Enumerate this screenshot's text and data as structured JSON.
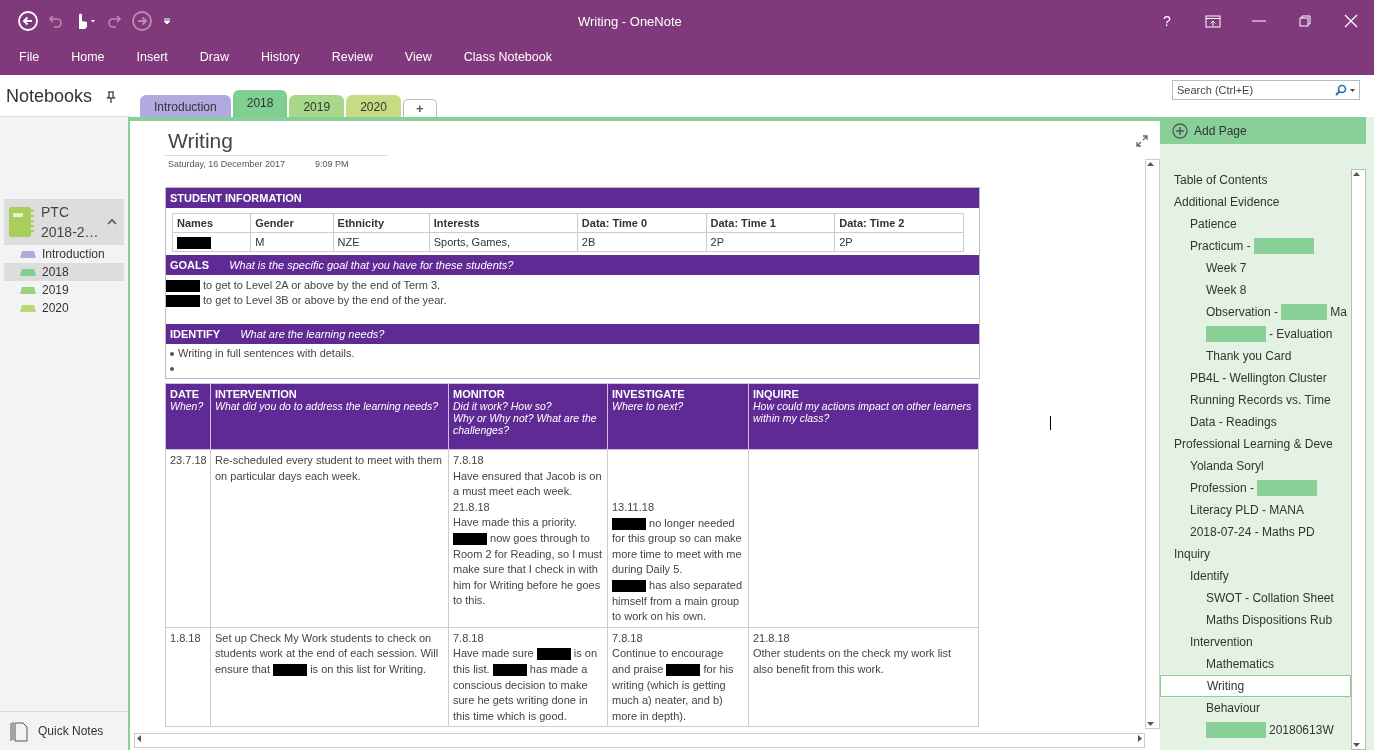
{
  "window": {
    "title": "Writing - OneNote",
    "help": "?"
  },
  "ribbon_tabs": [
    {
      "label": "File",
      "selected": false
    },
    {
      "label": "Home",
      "selected": false
    },
    {
      "label": "Insert",
      "selected": false
    },
    {
      "label": "Draw",
      "selected": false
    },
    {
      "label": "History",
      "selected": false
    },
    {
      "label": "Review",
      "selected": false
    },
    {
      "label": "View",
      "selected": false
    },
    {
      "label": "Class Notebook",
      "selected": false
    }
  ],
  "notebooks_pane": {
    "header": "Notebooks",
    "notebook": {
      "name": "PTC 2018-2…",
      "expanded": true
    },
    "sections": [
      {
        "name": "Introduction",
        "color": "#b1aae0",
        "selected": false
      },
      {
        "name": "2018",
        "color": "#7fcf92",
        "selected": true
      },
      {
        "name": "2019",
        "color": "#97d27f",
        "selected": false
      },
      {
        "name": "2020",
        "color": "#b8d874",
        "selected": false
      }
    ],
    "footer": "Quick Notes"
  },
  "section_tabs": [
    {
      "name": "Introduction",
      "color": "#b1aae0",
      "selected": false
    },
    {
      "name": "2018",
      "color": "#7fcf92",
      "selected": true
    },
    {
      "name": "2019",
      "color": "#a8d88a",
      "selected": false
    },
    {
      "name": "2020",
      "color": "#c5dc82",
      "selected": false
    }
  ],
  "add_section": "+",
  "search": {
    "placeholder": "Search (Ctrl+E)"
  },
  "page": {
    "title": "Writing",
    "date": "Saturday, 16 December 2017",
    "time": "9:09 PM",
    "student_info": {
      "heading": "STUDENT INFORMATION",
      "columns": [
        "Names",
        "Gender",
        "Ethnicity",
        "Interests",
        "Data: Time 0",
        "Data: Time 1",
        "Data: Time 2"
      ],
      "row": [
        [
          {
            "kind": "redaction"
          }
        ],
        [
          "M"
        ],
        [
          "NZE"
        ],
        [
          "Sports, Games,"
        ],
        [
          "2B"
        ],
        [
          "2P"
        ],
        [
          "2P"
        ]
      ]
    },
    "goals": {
      "heading": "GOALS",
      "prompt": "What is the specific goal that you have for these students?",
      "lines": [
        [
          {
            "kind": "redaction"
          },
          "to get to Level 2A or above by the end of Term 3."
        ],
        [
          {
            "kind": "redaction"
          },
          "to get to Level 3B or above by the end of the year."
        ]
      ]
    },
    "identify": {
      "heading": "IDENTIFY",
      "prompt": "What are the learning needs?",
      "bullets": [
        {
          "kind": "text",
          "text": "Writing in full sentences with details."
        },
        {
          "kind": "empty"
        }
      ]
    },
    "log": {
      "columns": [
        {
          "title": "DATE",
          "prompt": "When?"
        },
        {
          "title": "INTERVENTION",
          "prompt": "What did you do to address the learning needs?"
        },
        {
          "title": "MONITOR",
          "prompt": "Did it work? How so?\nWhy or Why not? What are the challenges?"
        },
        {
          "title": "INVESTIGATE",
          "prompt": "Where to next?"
        },
        {
          "title": "INQUIRE",
          "prompt": "How could my actions impact on other learners within my class?"
        }
      ],
      "rows": [
        [
          [
            [
              "23.7.18"
            ]
          ],
          [
            [
              "Re-scheduled every student to meet with them on particular days each week."
            ]
          ],
          [
            [
              "7.8.18"
            ],
            [
              "Have ensured that Jacob is on a must meet each week."
            ],
            [
              "21.8.18"
            ],
            [
              "Have made this a priority."
            ],
            [
              {
                "kind": "redaction"
              },
              "now goes through to Room 2 for Reading, so I must make sure that I check in with him for Writing before he goes to this."
            ]
          ],
          [
            [
              {
                "kind": "spacer"
              }
            ],
            [
              "13.11.18"
            ],
            [
              {
                "kind": "redaction"
              },
              "no longer needed for this group so can make more time to meet with me during Daily 5."
            ],
            [
              {
                "kind": "redaction"
              },
              "has also separated himself from a main group to work on his own."
            ]
          ],
          []
        ],
        [
          [
            [
              "1.8.18"
            ]
          ],
          [
            [
              "Set up Check My Work students to check on students work at the end of each session. Will ensure that",
              {
                "kind": "redaction"
              },
              "is on this list for Writing."
            ]
          ],
          [
            [
              "7.8.18"
            ],
            [
              "Have made sure",
              {
                "kind": "redaction"
              },
              "is on this list.",
              {
                "kind": "redaction"
              },
              "has made a conscious decision to make sure he gets writing done in this time which is good."
            ]
          ],
          [
            [
              "7.8.18"
            ],
            [
              "Continue to encourage and praise",
              {
                "kind": "redaction"
              },
              "for his writing (which is getting much a) neater, and b) more in depth)."
            ]
          ],
          [
            [
              "21.8.18"
            ],
            [
              "Other students on the check my work list also benefit from this work."
            ]
          ]
        ]
      ]
    }
  },
  "pages_pane": {
    "add_page": "Add Page",
    "pages": [
      {
        "parts": [
          "Table of Contents"
        ],
        "selected": false
      },
      {
        "parts": [
          "Additional Evidence"
        ],
        "selected": false,
        "children": [
          {
            "parts": [
              "Patience"
            ],
            "selected": false
          },
          {
            "parts": [
              "Practicum -",
              {
                "kind": "redaction"
              }
            ],
            "selected": false,
            "children": [
              {
                "parts": [
                  "Week 7"
                ],
                "selected": false
              },
              {
                "parts": [
                  "Week 8"
                ],
                "selected": false
              },
              {
                "parts": [
                  "Observation -",
                  {
                    "kind": "redaction"
                  },
                  "Ma"
                ],
                "selected": false
              },
              {
                "parts": [
                  {
                    "kind": "redaction"
                  },
                  "- Evaluation"
                ],
                "selected": false
              },
              {
                "parts": [
                  "Thank you Card"
                ],
                "selected": false
              }
            ]
          },
          {
            "parts": [
              "PB4L - Wellington Cluster"
            ],
            "selected": false
          },
          {
            "parts": [
              "Running Records vs. Time"
            ],
            "selected": false
          },
          {
            "parts": [
              "Data - Readings"
            ],
            "selected": false
          }
        ]
      },
      {
        "parts": [
          "Professional Learning & Deve"
        ],
        "selected": false,
        "children": [
          {
            "parts": [
              "Yolanda Soryl"
            ],
            "selected": false
          },
          {
            "parts": [
              "Profession -",
              {
                "kind": "redaction"
              }
            ],
            "selected": false
          },
          {
            "parts": [
              "Literacy PLD - MANA"
            ],
            "selected": false
          },
          {
            "parts": [
              "2018-07-24 - Maths PD"
            ],
            "selected": false
          }
        ]
      },
      {
        "parts": [
          "Inquiry"
        ],
        "selected": false,
        "children": [
          {
            "parts": [
              "Identify"
            ],
            "selected": false,
            "children": [
              {
                "parts": [
                  "SWOT - Collation Sheet"
                ],
                "selected": false
              },
              {
                "parts": [
                  "Maths Dispositions Rub"
                ],
                "selected": false
              }
            ]
          },
          {
            "parts": [
              "Intervention"
            ],
            "selected": false,
            "children": [
              {
                "parts": [
                  "Mathematics"
                ],
                "selected": false
              },
              {
                "parts": [
                  "Writing"
                ],
                "selected": true
              },
              {
                "parts": [
                  "Behaviour"
                ],
                "selected": false
              },
              {
                "parts": [
                  {
                    "kind": "redaction"
                  },
                  "20180613W"
                ],
                "selected": false
              }
            ]
          }
        ]
      }
    ]
  }
}
